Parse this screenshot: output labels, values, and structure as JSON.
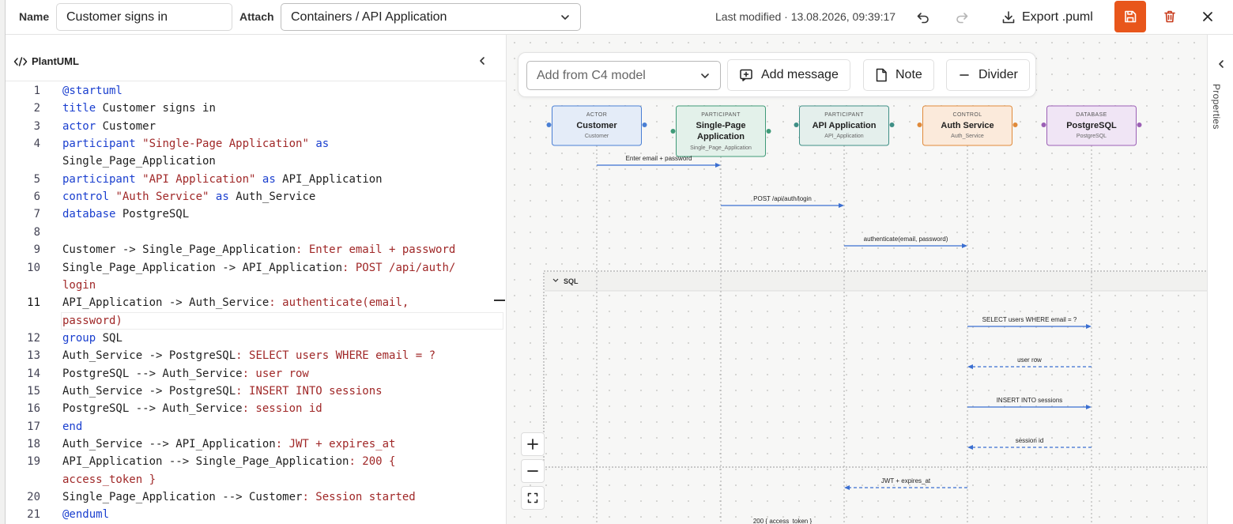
{
  "topbar": {
    "name_label": "Name",
    "name_value": "Customer signs in",
    "attach_label": "Attach",
    "attach_value": "Containers / API Application",
    "modified": "Last modified · 13.08.2026, 09:39:17",
    "export_label": "Export .puml",
    "icons": [
      "undo-icon",
      "redo-icon",
      "download-icon",
      "save-icon",
      "trash-icon",
      "close-icon"
    ],
    "accent": "#e8561b"
  },
  "editor": {
    "title": "PlantUML",
    "lines": [
      {
        "n": "1",
        "parts": [
          {
            "t": "@startuml",
            "c": "kw"
          }
        ]
      },
      {
        "n": "2",
        "parts": [
          {
            "t": "title",
            "c": "kw"
          },
          {
            "t": " Customer signs in",
            "c": ""
          }
        ]
      },
      {
        "n": "3",
        "parts": [
          {
            "t": "actor",
            "c": "kw"
          },
          {
            "t": " Customer",
            "c": ""
          }
        ]
      },
      {
        "n": "4",
        "parts": [
          {
            "t": "participant",
            "c": "kw"
          },
          {
            "t": " ",
            "c": ""
          },
          {
            "t": "\"Single-Page Application\"",
            "c": "str"
          },
          {
            "t": " ",
            "c": ""
          },
          {
            "t": "as",
            "c": "kw"
          }
        ]
      },
      {
        "n": "",
        "parts": [
          {
            "t": "Single_Page_Application",
            "c": ""
          }
        ]
      },
      {
        "n": "5",
        "parts": [
          {
            "t": "participant",
            "c": "kw"
          },
          {
            "t": " ",
            "c": ""
          },
          {
            "t": "\"API Application\"",
            "c": "str"
          },
          {
            "t": " ",
            "c": ""
          },
          {
            "t": "as",
            "c": "kw"
          },
          {
            "t": " API_Application",
            "c": ""
          }
        ]
      },
      {
        "n": "6",
        "parts": [
          {
            "t": "control",
            "c": "kw"
          },
          {
            "t": " ",
            "c": ""
          },
          {
            "t": "\"Auth Service\"",
            "c": "str"
          },
          {
            "t": " ",
            "c": ""
          },
          {
            "t": "as",
            "c": "kw"
          },
          {
            "t": " Auth_Service",
            "c": ""
          }
        ]
      },
      {
        "n": "7",
        "parts": [
          {
            "t": "database",
            "c": "kw"
          },
          {
            "t": " PostgreSQL",
            "c": ""
          }
        ]
      },
      {
        "n": "8",
        "parts": []
      },
      {
        "n": "9",
        "parts": [
          {
            "t": "Customer -> Single_Page_Application",
            "c": ""
          },
          {
            "t": ": Enter email + password",
            "c": "str"
          }
        ]
      },
      {
        "n": "10",
        "parts": [
          {
            "t": "Single_Page_Application -> API_Application",
            "c": ""
          },
          {
            "t": ": POST /api/auth/",
            "c": "str"
          }
        ]
      },
      {
        "n": "",
        "parts": [
          {
            "t": "login",
            "c": "str"
          }
        ]
      },
      {
        "n": "11",
        "parts": [
          {
            "t": "API_Application -> Auth_Service",
            "c": ""
          },
          {
            "t": ": authenticate(email,",
            "c": "str"
          }
        ]
      },
      {
        "n": "",
        "parts": [
          {
            "t": "password)",
            "c": "str"
          }
        ]
      },
      {
        "n": "12",
        "parts": [
          {
            "t": "group",
            "c": "kw"
          },
          {
            "t": " SQL",
            "c": ""
          }
        ]
      },
      {
        "n": "13",
        "parts": [
          {
            "t": "Auth_Service -> PostgreSQL",
            "c": ""
          },
          {
            "t": ": SELECT users WHERE email = ?",
            "c": "str"
          }
        ]
      },
      {
        "n": "14",
        "parts": [
          {
            "t": "PostgreSQL --> Auth_Service",
            "c": ""
          },
          {
            "t": ": user row",
            "c": "str"
          }
        ]
      },
      {
        "n": "15",
        "parts": [
          {
            "t": "Auth_Service -> PostgreSQL",
            "c": ""
          },
          {
            "t": ": INSERT INTO sessions",
            "c": "str"
          }
        ]
      },
      {
        "n": "16",
        "parts": [
          {
            "t": "PostgreSQL --> Auth_Service",
            "c": ""
          },
          {
            "t": ": session id",
            "c": "str"
          }
        ]
      },
      {
        "n": "17",
        "parts": [
          {
            "t": "end",
            "c": "kw"
          }
        ]
      },
      {
        "n": "18",
        "parts": [
          {
            "t": "Auth_Service --> API_Application",
            "c": ""
          },
          {
            "t": ": JWT + expires_at",
            "c": "str"
          }
        ]
      },
      {
        "n": "19",
        "parts": [
          {
            "t": "API_Application --> Single_Page_Application",
            "c": ""
          },
          {
            "t": ": 200 {",
            "c": "str"
          }
        ]
      },
      {
        "n": "",
        "parts": [
          {
            "t": "access_token }",
            "c": "str"
          }
        ]
      },
      {
        "n": "20",
        "parts": [
          {
            "t": "Single_Page_Application --> Customer",
            "c": ""
          },
          {
            "t": ": Session started",
            "c": "str"
          }
        ]
      },
      {
        "n": "21",
        "parts": [
          {
            "t": "@enduml",
            "c": "kw"
          }
        ]
      }
    ]
  },
  "canvas_toolbar": {
    "add_from_placeholder": "Add from C4 model",
    "add_message": "Add message",
    "note": "Note",
    "divider": "Divider"
  },
  "diagram": {
    "participants": [
      {
        "kind": "ACTOR",
        "name": "Customer",
        "alias": "Customer",
        "color": "#4a7fd4",
        "fill": "#e4ecf8"
      },
      {
        "kind": "PARTICIPANT",
        "name": "Single-Page Application",
        "alias": "Single_Page_Application",
        "color": "#3f9a78",
        "fill": "#e3f1ea"
      },
      {
        "kind": "PARTICIPANT",
        "name": "API Application",
        "alias": "API_Application",
        "color": "#3f8f86",
        "fill": "#e4efec"
      },
      {
        "kind": "CONTROL",
        "name": "Auth Service",
        "alias": "Auth_Service",
        "color": "#e08a3a",
        "fill": "#fbeadb"
      },
      {
        "kind": "DATABASE",
        "name": "PostgreSQL",
        "alias": "PostgreSQL",
        "color": "#9b5fb5",
        "fill": "#f0e5f5"
      }
    ],
    "group_label": "SQL",
    "messages": [
      {
        "from": 0,
        "to": 1,
        "label": "Enter email + password",
        "dashed": false
      },
      {
        "from": 1,
        "to": 2,
        "label": "POST /api/auth/login",
        "dashed": false
      },
      {
        "from": 2,
        "to": 3,
        "label": "authenticate(email, password)",
        "dashed": false
      },
      {
        "from": 3,
        "to": 4,
        "label": "SELECT users WHERE email = ?",
        "dashed": false
      },
      {
        "from": 4,
        "to": 3,
        "label": "user row",
        "dashed": true
      },
      {
        "from": 3,
        "to": 4,
        "label": "INSERT INTO sessions",
        "dashed": false
      },
      {
        "from": 4,
        "to": 3,
        "label": "session id",
        "dashed": true
      },
      {
        "from": 3,
        "to": 2,
        "label": "JWT + expires_at",
        "dashed": true
      },
      {
        "from": 2,
        "to": 1,
        "label": "200 { access_token }",
        "dashed": true
      }
    ],
    "arrow_color": "#3b6fd1"
  },
  "right_panel": {
    "label": "Properties"
  }
}
